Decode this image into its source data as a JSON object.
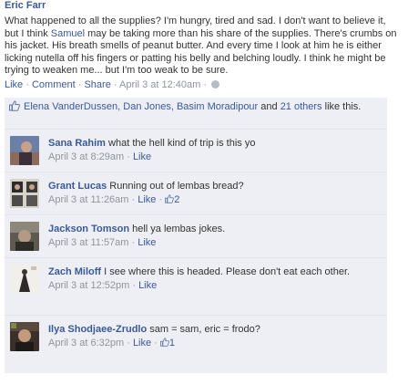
{
  "post": {
    "author": "Eric Farr",
    "text_before_mention": "What happened to all the supplies? I'm hungry, tired and sad. I don't want to believe it, but I think ",
    "mention": "Samuel",
    "text_after_mention": " may be taking more than his share of the supplies. There's crumbs on his jacket. His breath smells of peanut butter. And every time I look at him he is either licking nutella off his fingers or patting his belly and belching loudly. I think he might be trying to weaken me... but I'm too weak to be sure.",
    "actions": {
      "like": "Like",
      "comment": "Comment",
      "share": "Share",
      "date": "April 3 at 12:40am"
    }
  },
  "likes": {
    "names": "Elena VanderDussen, Dan Jones, Basim Moradipour",
    "and": " and ",
    "others": "21 others",
    "suffix": " like this."
  },
  "comments": [
    {
      "name": "Sana Rahim",
      "text": " what the hell kind of trip is this yo",
      "date": "April 3 at 8:29am",
      "like": "Like",
      "like_count": ""
    },
    {
      "name": "Grant Lucas",
      "text": " Running out of lembas bread?",
      "date": "April 3 at 11:26am",
      "like": "Like",
      "like_count": "2"
    },
    {
      "name": "Jackson Tomson",
      "text": " hell ya lembas jokes.",
      "date": "April 3 at 11:57am",
      "like": "Like",
      "like_count": ""
    },
    {
      "name": "Zach Miloff",
      "text": " I see where this is headed. Please don't eat each other.",
      "date": "April 3 at 12:52pm",
      "like": "Like",
      "like_count": ""
    },
    {
      "name": "Ilya Shodjaee-Zrudlo",
      "text": " sam = sam, eric = frodo?",
      "date": "April 3 at 6:32pm",
      "like": "Like",
      "like_count": "1"
    }
  ],
  "colors": {
    "link": "#3b5998",
    "meta": "#90949c",
    "box": "#edeff4"
  }
}
